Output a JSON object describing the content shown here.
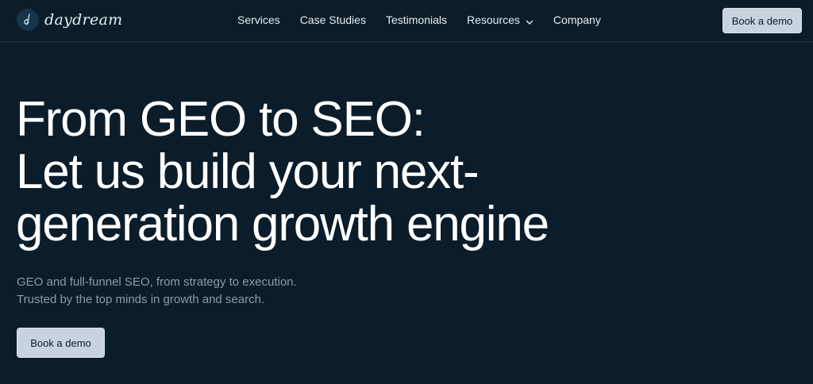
{
  "brand": {
    "name": "daydream",
    "logo_icon": "daydream-logo-icon"
  },
  "nav": {
    "links": [
      {
        "label": "Services"
      },
      {
        "label": "Case Studies"
      },
      {
        "label": "Testimonials"
      },
      {
        "label": "Resources",
        "has_dropdown": true,
        "icon": "chevron-down-icon"
      },
      {
        "label": "Company"
      }
    ],
    "cta_label": "Book a demo"
  },
  "hero": {
    "title_lines": [
      "From GEO to SEO:",
      "Let us build your next-",
      "generation growth engine"
    ],
    "subtitle_lines": [
      "GEO and full-funnel SEO, from strategy to execution.",
      "Trusted by the top minds in growth and search."
    ],
    "cta_label": "Book a demo"
  },
  "colors": {
    "background": "#0b1d2a",
    "button_bg": "#c7d4df",
    "button_text": "#0b1d2a",
    "subtitle_text": "#8e9ba6"
  }
}
